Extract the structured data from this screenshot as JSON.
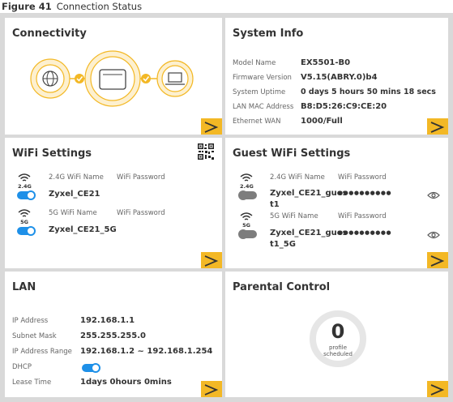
{
  "caption": {
    "label": "Figure 41",
    "text": "Connection Status"
  },
  "connectivity": {
    "title": "Connectivity"
  },
  "system_info": {
    "title": "System Info",
    "rows": [
      {
        "label": "Model Name",
        "value": "EX5501-B0"
      },
      {
        "label": "Firmware Version",
        "value": "V5.15(ABRY.0)b4"
      },
      {
        "label": "System Uptime",
        "value": "0 days 5 hours 50 mins 18 secs"
      },
      {
        "label": "LAN MAC Address",
        "value": "B8:D5:26:C9:CE:20"
      },
      {
        "label": "Ethernet WAN",
        "value": "1000/Full"
      }
    ]
  },
  "wifi_settings": {
    "title": "WiFi Settings",
    "bands": [
      {
        "band": "2.4G",
        "name_label": "2.4G WiFi Name",
        "password_label": "WiFi Password",
        "ssid": "Zyxel_CE21",
        "enabled": true
      },
      {
        "band": "5G",
        "name_label": "5G WiFi Name",
        "password_label": "WiFi Password",
        "ssid": "Zyxel_CE21_5G",
        "enabled": true
      }
    ]
  },
  "guest_wifi": {
    "title": "Guest WiFi Settings",
    "bands": [
      {
        "band": "2.4G",
        "name_label": "2.4G WiFi Name",
        "password_label": "WiFi Password",
        "ssid_line1": "Zyxel_CE21_gues",
        "ssid_line2": "t1",
        "password_mask": "●●●●●●●●●●",
        "enabled": false
      },
      {
        "band": "5G",
        "name_label": "5G WiFi Name",
        "password_label": "WiFi Password",
        "ssid_line1": "Zyxel_CE21_gues",
        "ssid_line2": "t1_5G",
        "password_mask": "●●●●●●●●●●",
        "enabled": false
      }
    ]
  },
  "lan": {
    "title": "LAN",
    "rows": [
      {
        "label": "IP Address",
        "value": "192.168.1.1"
      },
      {
        "label": "Subnet Mask",
        "value": "255.255.255.0"
      },
      {
        "label": "IP Address Range",
        "value": "192.168.1.2 ~ 192.168.1.254"
      },
      {
        "label": "DHCP",
        "value": ""
      },
      {
        "label": "Lease Time",
        "value": "1days 0hours 0mins"
      }
    ],
    "dhcp_enabled": true
  },
  "parental_control": {
    "title": "Parental Control",
    "count": "0",
    "count_label_line1": "profile",
    "count_label_line2": "scheduled"
  },
  "colors": {
    "accent": "#f3b825",
    "toggle_on": "#1e90e8",
    "toggle_off": "#7d7d7d",
    "frame": "#d9d9d9"
  },
  "icons": [
    "globe-icon",
    "router-icon",
    "laptop-icon",
    "check-icon",
    "qr-code-icon",
    "wifi-icon",
    "eye-icon",
    "chevron-right-icon"
  ]
}
